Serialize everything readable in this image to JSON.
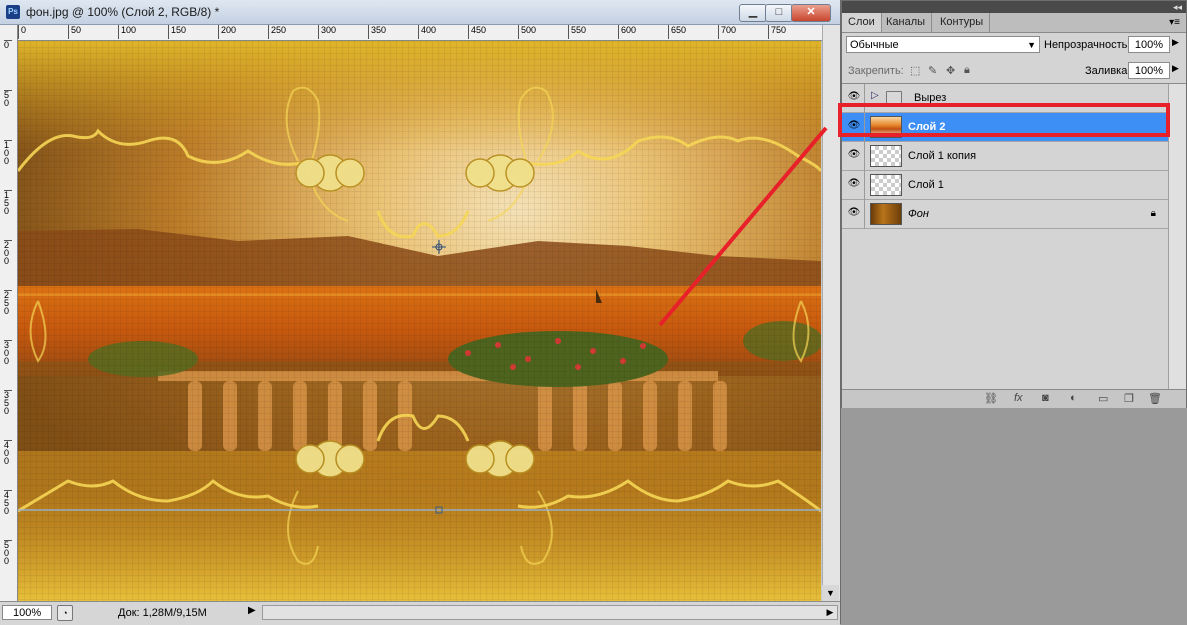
{
  "window": {
    "ps_badge": "Ps",
    "title": "фон.jpg @ 100% (Слой 2, RGB/8) *",
    "min_glyph": "▁",
    "max_glyph": "□",
    "close_glyph": "✕"
  },
  "ruler": {
    "h_ticks": [
      "0",
      "50",
      "100",
      "150",
      "200",
      "250",
      "300",
      "350",
      "400",
      "450",
      "500",
      "550",
      "600",
      "650",
      "700",
      "750"
    ],
    "v_ticks": [
      "0",
      "50",
      "100",
      "150",
      "200",
      "250",
      "300",
      "350",
      "400",
      "450",
      "500"
    ]
  },
  "status": {
    "zoom": "100%",
    "doc_info": "Док: 1,28M/9,15M",
    "arrow_glyph": "▶",
    "scroll_right_glyph": "▶",
    "scroll_down_glyph": "▼"
  },
  "panel": {
    "tabs": [
      {
        "label": "Слои",
        "active": true
      },
      {
        "label": "Каналы",
        "active": false
      },
      {
        "label": "Контуры",
        "active": false
      }
    ],
    "collapse_glyph": "◂◂",
    "menu_glyph": "▾≡",
    "blend_mode": "Обычные",
    "opacity_label": "Непрозрачность:",
    "opacity_value": "100%",
    "lock_label": "Закрепить:",
    "fill_label": "Заливка:",
    "fill_value": "100%",
    "layers": [
      {
        "name": "Вырез",
        "type": "group",
        "visible": true,
        "selected": false
      },
      {
        "name": "Слой 2",
        "type": "layer",
        "visible": true,
        "selected": true
      },
      {
        "name": "Слой 1 копия",
        "type": "layer",
        "visible": true,
        "selected": false
      },
      {
        "name": "Слой 1",
        "type": "layer",
        "visible": true,
        "selected": false
      },
      {
        "name": "Фон",
        "type": "background",
        "visible": true,
        "selected": false,
        "locked": true
      }
    ],
    "bottom_icons": [
      "link-icon",
      "fx-icon",
      "mask-icon",
      "adjustment-icon",
      "folder-icon",
      "new-layer-icon",
      "trash-icon"
    ]
  },
  "colors": {
    "selected_layer": "#3d8ef5",
    "annotation_red": "#e8202a"
  }
}
